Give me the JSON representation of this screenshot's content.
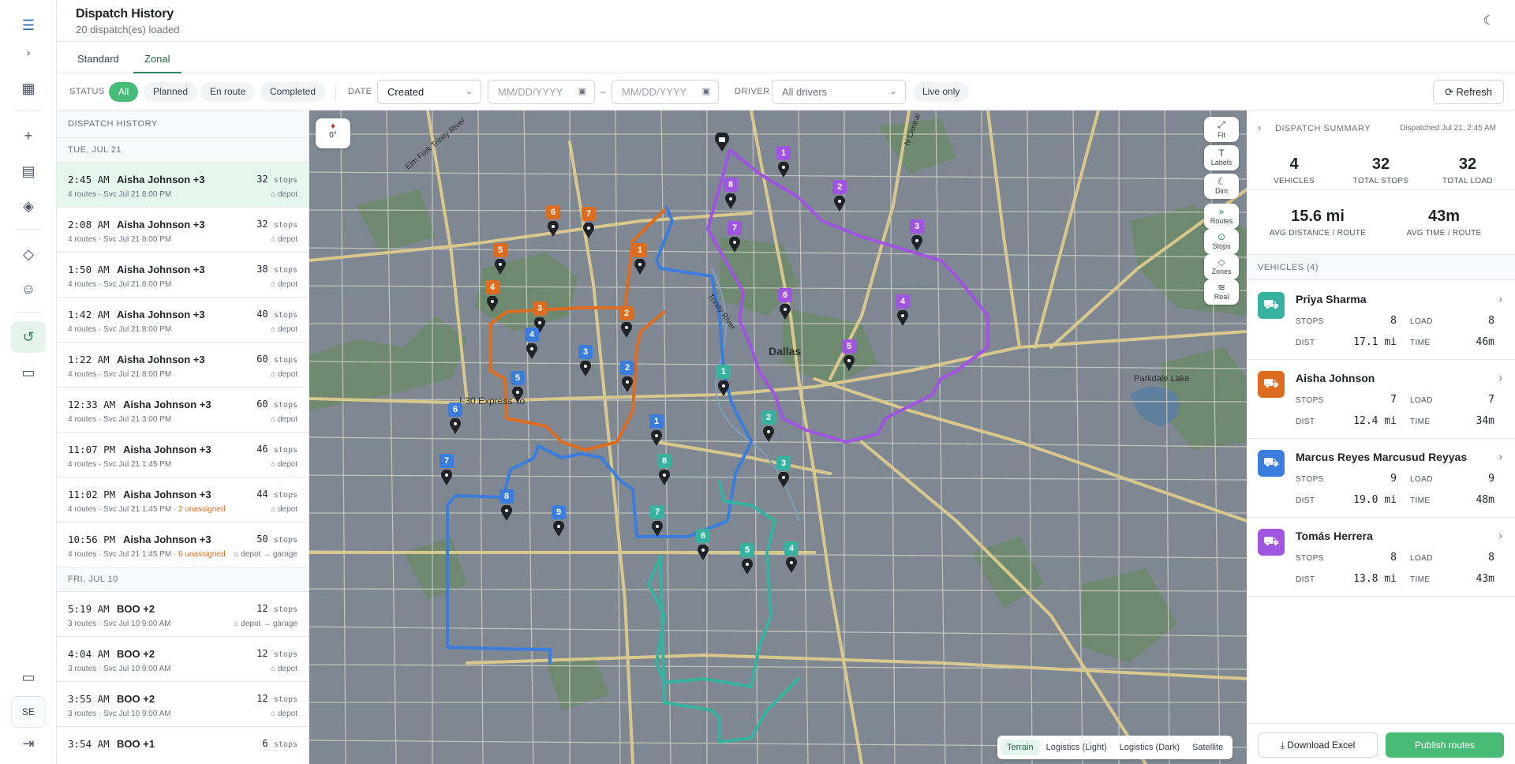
{
  "header": {
    "title": "Dispatch History",
    "subtitle": "20 dispatch(es) loaded"
  },
  "user": {
    "initials": "SE"
  },
  "tabs": [
    {
      "label": "Standard"
    },
    {
      "label": "Zonal"
    }
  ],
  "filters": {
    "status_label": "STATUS",
    "status_options": [
      "All",
      "Planned",
      "En route",
      "Completed"
    ],
    "date_label": "DATE",
    "date_select": "Created",
    "date_from_placeholder": "MM/DD/YYYY",
    "date_to_placeholder": "MM/DD/YYYY",
    "date_sep": "–",
    "driver_label": "DRIVER",
    "driver_select": "All drivers",
    "live_only": "Live only",
    "refresh": "Refresh"
  },
  "list": {
    "title": "DISPATCH HISTORY",
    "stops_unit": "stops",
    "groups": [
      {
        "day": "TUE, JUL 21",
        "rows": [
          {
            "time": "2:45 AM",
            "name": "Aisha Johnson +3",
            "stops": "32",
            "meta": "4 routes · Svc Jul 21 8:00 PM",
            "warn": "",
            "dest": "depot"
          },
          {
            "time": "2:08 AM",
            "name": "Aisha Johnson +3",
            "stops": "32",
            "meta": "4 routes · Svc Jul 21 8:00 PM",
            "warn": "",
            "dest": "depot"
          },
          {
            "time": "1:50 AM",
            "name": "Aisha Johnson +3",
            "stops": "38",
            "meta": "4 routes · Svc Jul 21 8:00 PM",
            "warn": "",
            "dest": "depot"
          },
          {
            "time": "1:42 AM",
            "name": "Aisha Johnson +3",
            "stops": "40",
            "meta": "4 routes · Svc Jul 21 8:00 PM",
            "warn": "",
            "dest": "depot"
          },
          {
            "time": "1:22 AM",
            "name": "Aisha Johnson +3",
            "stops": "60",
            "meta": "4 routes · Svc Jul 21 8:00 PM",
            "warn": "",
            "dest": "depot"
          },
          {
            "time": "12:33 AM",
            "name": "Aisha Johnson +3",
            "stops": "60",
            "meta": "4 routes · Svc Jul 21 3:00 PM",
            "warn": "",
            "dest": "depot"
          },
          {
            "time": "11:07 PM",
            "name": "Aisha Johnson +3",
            "stops": "46",
            "meta": "4 routes · Svc Jul 21 1:45 PM",
            "warn": "",
            "dest": "depot"
          },
          {
            "time": "11:02 PM",
            "name": "Aisha Johnson +3",
            "stops": "44",
            "meta": "4 routes · Svc Jul 21 1:45 PM",
            "warn": "· 2 unassigned",
            "dest": "depot"
          },
          {
            "time": "10:56 PM",
            "name": "Aisha Johnson +3",
            "stops": "50",
            "meta": "4 routes · Svc Jul 21 1:45 PM",
            "warn": "· 6 unassigned",
            "dest": "depot → garage"
          }
        ]
      },
      {
        "day": "FRI, JUL 10",
        "rows": [
          {
            "time": "5:19 AM",
            "name": "BOO +2",
            "stops": "12",
            "meta": "3 routes · Svc Jul 10 9:00 AM",
            "warn": "",
            "dest": "depot → garage"
          },
          {
            "time": "4:04 AM",
            "name": "BOO +2",
            "stops": "12",
            "meta": "3 routes · Svc Jul 10 9:00 AM",
            "warn": "",
            "dest": "depot"
          },
          {
            "time": "3:55 AM",
            "name": "BOO +2",
            "stops": "12",
            "meta": "3 routes · Svc Jul 10 9:00 AM",
            "warn": "",
            "dest": "depot"
          },
          {
            "time": "3:54 AM",
            "name": "BOO +1",
            "stops": "6",
            "meta": "",
            "warn": "",
            "dest": ""
          }
        ]
      }
    ]
  },
  "map": {
    "compass": "0°",
    "controls": [
      "Fit",
      "Labels",
      "Dim",
      "Routes",
      "Stops",
      "Zones",
      "Real"
    ],
    "layers": [
      "Terrain",
      "Logistics (Light)",
      "Logistics (Dark)",
      "Satellite"
    ],
    "labels": {
      "city": "Dallas",
      "road": "I-30 Express To",
      "river": "Trinity River",
      "lake": "Parkdale Lake",
      "rd1": "Elm Fork Trinity River",
      "rd2": "N Central"
    },
    "colors": {
      "orange": "#dd6b20",
      "blue": "#3b7ddd",
      "purple": "#9f55e0",
      "teal": "#38b2a0"
    }
  },
  "summary": {
    "title": "DISPATCH SUMMARY",
    "dispatched": "Dispatched Jul 21, 2:45 AM",
    "stats": [
      {
        "value": "4",
        "label": "VEHICLES"
      },
      {
        "value": "32",
        "label": "TOTAL STOPS"
      },
      {
        "value": "32",
        "label": "TOTAL LOAD"
      },
      {
        "value": "15.6 mi",
        "label": "AVG DISTANCE / ROUTE"
      },
      {
        "value": "43m",
        "label": "AVG TIME / ROUTE"
      }
    ],
    "vehicles_title": "VEHICLES (4)",
    "keys": {
      "stops": "STOPS",
      "load": "LOAD",
      "dist": "DIST",
      "time": "TIME"
    },
    "vehicles": [
      {
        "name": "Priya Sharma",
        "color": "#38b2a0",
        "stops": "8",
        "load": "8",
        "dist": "17.1 mi",
        "time": "46m"
      },
      {
        "name": "Aisha Johnson",
        "color": "#dd6b20",
        "stops": "7",
        "load": "7",
        "dist": "12.4 mi",
        "time": "34m"
      },
      {
        "name": "Marcus Reyes Marcusud Reyyas",
        "color": "#3b7ddd",
        "stops": "9",
        "load": "9",
        "dist": "19.0 mi",
        "time": "48m"
      },
      {
        "name": "Tomás Herrera",
        "color": "#9f55e0",
        "stops": "8",
        "load": "8",
        "dist": "13.8 mi",
        "time": "43m"
      }
    ],
    "download": "Download Excel",
    "publish": "Publish routes"
  }
}
